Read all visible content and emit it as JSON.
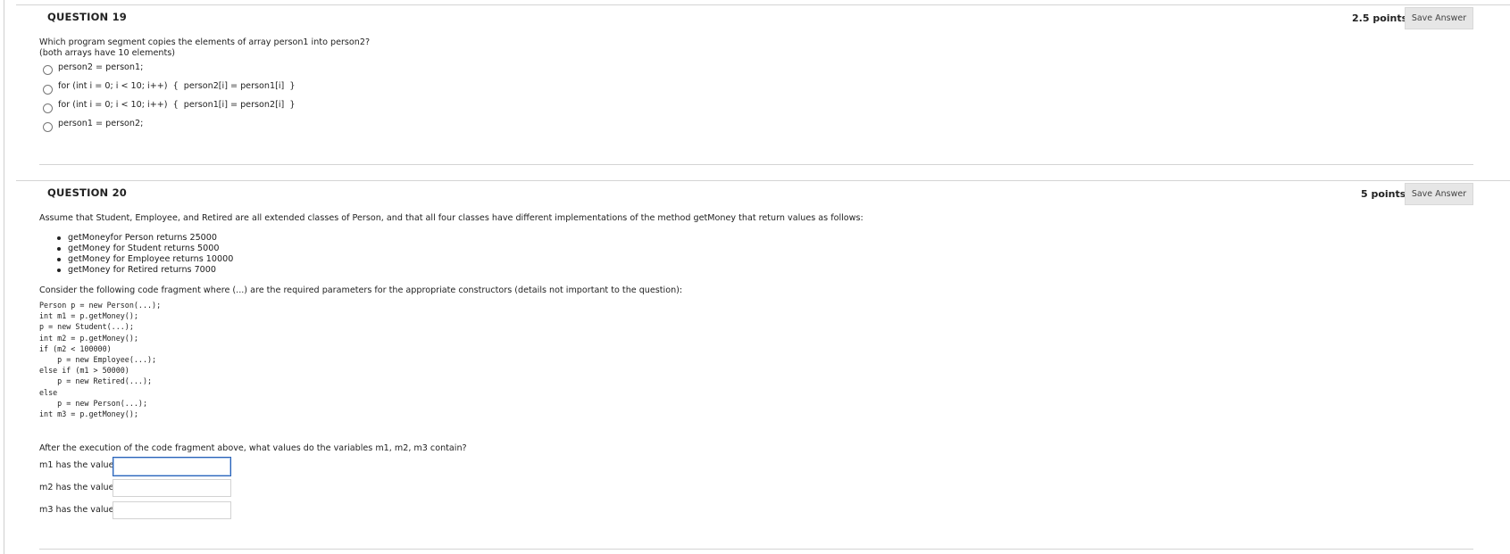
{
  "q19": {
    "title": "QUESTION 19",
    "points": "2.5 points",
    "save_label": "Save Answer",
    "prompt_line1": "Which program segment copies the elements of array person1 into person2?",
    "prompt_line2": "(both arrays have 10 elements)",
    "options": [
      "person2 = person1;",
      "for (int i = 0; i < 10; i++)  {  person2[i] = person1[i]  }",
      "for (int i = 0; i < 10; i++)  {  person1[i] = person2[i]  }",
      "person1 = person2;"
    ]
  },
  "q20": {
    "title": "QUESTION 20",
    "points": "5 points",
    "save_label": "Save Answer",
    "intro": "Assume that Student, Employee, and Retired are all extended classes of Person, and that all four classes have different implementations of the method getMoney that return values as follows:",
    "bullets": [
      "getMoneyfor Person returns 25000",
      "getMoney for Student returns 5000",
      "getMoney for Employee returns 10000",
      "getMoney for Retired returns 7000"
    ],
    "consider": "Consider the following code fragment where (...) are the required parameters for the appropriate constructors (details not important to the question):",
    "code_lines": [
      "Person p = new Person(...);",
      "int m1 = p.getMoney();",
      "p = new Student(...);",
      "int m2 = p.getMoney();",
      "if (m2 < 100000)",
      "    p = new Employee(...);",
      "else if (m1 > 50000)",
      "    p = new Retired(...);",
      "else",
      "    p = new Person(...);",
      "int m3 = p.getMoney();"
    ],
    "after": "After the execution of the code fragment above, what values do the variables m1, m2, m3 contain?",
    "m1_label": "m1 has the value",
    "m2_label": "m2 has the value",
    "m3_label": "m3 has the value",
    "m1_value": "",
    "m2_value": "",
    "m3_value": ""
  }
}
